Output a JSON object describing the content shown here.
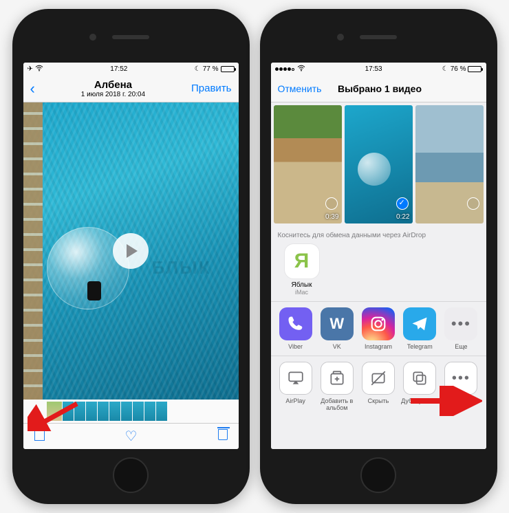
{
  "colors": {
    "ios_blue": "#007aff",
    "arrow_red": "#e21b1b"
  },
  "left": {
    "status": {
      "time": "17:52",
      "battery": "77 %"
    },
    "nav": {
      "back_chevron": "‹",
      "title": "Албена",
      "subtitle": "1 июля 2018 г. 20:04",
      "edit": "Править"
    },
    "toolbar": {
      "share": "Share",
      "favorite": "Favorite",
      "delete": "Delete"
    }
  },
  "right": {
    "status": {
      "time": "17:53",
      "battery": "76 %"
    },
    "nav": {
      "cancel": "Отменить",
      "title": "Выбрано 1 видео"
    },
    "thumbs": [
      {
        "duration": "0:39",
        "selected": false
      },
      {
        "duration": "0:22",
        "selected": true
      },
      {
        "duration": "",
        "selected": false
      }
    ],
    "airdrop_hint": "Коснитесь для обмена данными через AirDrop",
    "contact": {
      "initial": "Я",
      "name": "Яблык",
      "device": "iMac"
    },
    "apps": [
      {
        "label": "Viber"
      },
      {
        "label": "VK"
      },
      {
        "label": "Instagram"
      },
      {
        "label": "Telegram"
      },
      {
        "label": "Еще"
      }
    ],
    "actions": [
      {
        "label": "AirPlay"
      },
      {
        "label": "Добавить в альбом"
      },
      {
        "label": "Скрыть"
      },
      {
        "label": "Дублировать"
      },
      {
        "label": "Еще"
      }
    ]
  },
  "watermark": "БЛЫК"
}
